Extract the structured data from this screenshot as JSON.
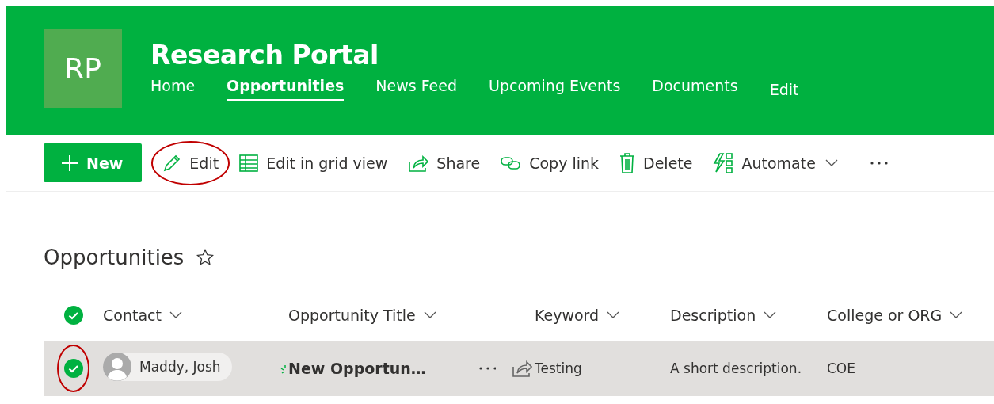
{
  "site": {
    "logo": "RP",
    "title": "Research Portal",
    "nav": [
      {
        "label": "Home",
        "selected": false
      },
      {
        "label": "Opportunities",
        "selected": true
      },
      {
        "label": "News Feed",
        "selected": false
      },
      {
        "label": "Upcoming Events",
        "selected": false
      },
      {
        "label": "Documents",
        "selected": false
      },
      {
        "label": "Edit",
        "selected": false
      }
    ]
  },
  "toolbar": [
    {
      "kind": "primary",
      "label": "New",
      "annotated": false
    },
    {
      "kind": "command",
      "label": "Edit",
      "annotated": true
    },
    {
      "kind": "command",
      "label": "Edit in grid view",
      "annotated": false
    },
    {
      "kind": "command",
      "label": "Share",
      "annotated": false
    },
    {
      "kind": "command",
      "label": "Copy link",
      "annotated": false
    },
    {
      "kind": "command",
      "label": "Delete",
      "annotated": false
    },
    {
      "kind": "dropdown",
      "label": "Automate",
      "annotated": false
    },
    {
      "kind": "overflow",
      "annotated": false
    }
  ],
  "list": {
    "title": "Opportunities",
    "favorite": false,
    "all_selected": true,
    "columns": [
      "Contact",
      "Opportunity Title",
      "Keyword",
      "Description",
      "College or ORG"
    ],
    "rows": [
      {
        "selected": true,
        "annotated": true,
        "contact": "Maddy, Josh",
        "title": "New Opportun…",
        "is_new": true,
        "keyword": "Testing",
        "description": "A short description.",
        "college": "COE"
      }
    ]
  }
}
